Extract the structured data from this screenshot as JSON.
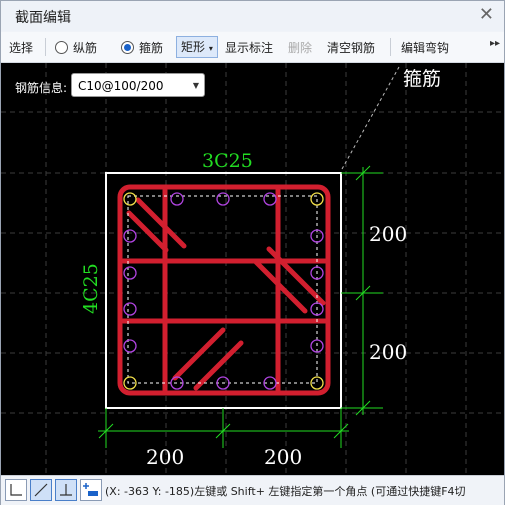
{
  "window": {
    "title": "截面编辑"
  },
  "toolbar": {
    "select_label": "选择",
    "radio_longitudinal": "纵筋",
    "radio_stirrup": "箍筋",
    "shape_dropdown": "矩形",
    "show_annotation": "显示标注",
    "delete_label": "删除",
    "clear_rebar": "清空钢筋",
    "edit_hook": "编辑弯钩"
  },
  "rebar_info": {
    "label": "钢筋信息:",
    "value": "C10@100/200"
  },
  "drawing": {
    "stirrup_annotation": "箍筋",
    "top_bars": "3C25",
    "left_bars": "4C25",
    "dim_right_top": "200",
    "dim_right_bottom": "200",
    "dim_bottom_left": "200",
    "dim_bottom_right": "200"
  },
  "status": {
    "text": "(X: -363 Y: -185)左键或 Shift+ 左键指定第一个角点 (可通过快捷键F4切"
  },
  "colors": {
    "rebar": "#d21f2f",
    "dimension": "#22dd22",
    "outline": "#ffffff",
    "bar_marker": "#b044e0"
  }
}
